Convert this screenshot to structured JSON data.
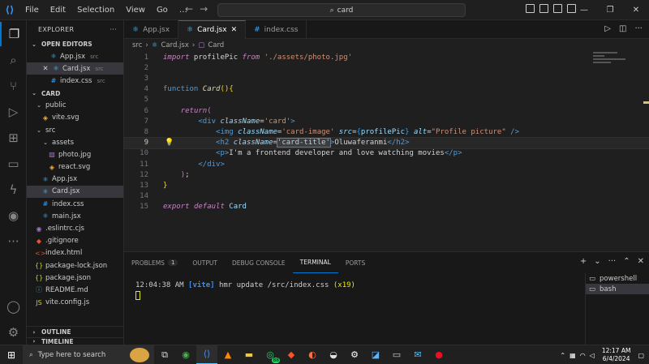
{
  "titlebar": {
    "menu": [
      "File",
      "Edit",
      "Selection",
      "View",
      "Go"
    ],
    "ellipsis": "…",
    "search": "card"
  },
  "sidebar": {
    "title": "EXPLORER",
    "more": "···",
    "open_editors_label": "OPEN EDITORS",
    "open_editors": [
      {
        "name": "App.jsx",
        "sub": "src",
        "icon": "react-icon",
        "close": false,
        "active": false
      },
      {
        "name": "Card.jsx",
        "sub": "src",
        "icon": "react-icon",
        "close": true,
        "active": true
      },
      {
        "name": "index.css",
        "sub": "src",
        "icon": "css-icon",
        "close": false,
        "active": false
      }
    ],
    "root_label": "CARD",
    "tree": [
      {
        "name": "public",
        "type": "folder",
        "depth": 1
      },
      {
        "name": "vite.svg",
        "type": "svg",
        "depth": 2
      },
      {
        "name": "src",
        "type": "folder",
        "depth": 1
      },
      {
        "name": "assets",
        "type": "folder",
        "depth": 2
      },
      {
        "name": "photo.jpg",
        "type": "img",
        "depth": 3
      },
      {
        "name": "react.svg",
        "type": "svg",
        "depth": 3
      },
      {
        "name": "App.jsx",
        "type": "react",
        "depth": 2
      },
      {
        "name": "Card.jsx",
        "type": "react",
        "depth": 2,
        "active": true
      },
      {
        "name": "index.css",
        "type": "css",
        "depth": 2
      },
      {
        "name": "main.jsx",
        "type": "react",
        "depth": 2
      },
      {
        "name": ".eslintrc.cjs",
        "type": "eslint",
        "depth": 1
      },
      {
        "name": ".gitignore",
        "type": "git",
        "depth": 1
      },
      {
        "name": "index.html",
        "type": "html",
        "depth": 1
      },
      {
        "name": "package-lock.json",
        "type": "json",
        "depth": 1
      },
      {
        "name": "package.json",
        "type": "json",
        "depth": 1
      },
      {
        "name": "README.md",
        "type": "md",
        "depth": 1
      },
      {
        "name": "vite.config.js",
        "type": "js",
        "depth": 1
      }
    ],
    "outline_label": "OUTLINE",
    "timeline_label": "TIMELINE"
  },
  "tabs": [
    {
      "label": "App.jsx",
      "active": false
    },
    {
      "label": "Card.jsx",
      "active": true
    },
    {
      "label": "index.css",
      "active": false
    }
  ],
  "breadcrumb": {
    "folder": "src",
    "file": "Card.jsx",
    "symbol": "Card"
  },
  "editor": {
    "current_line": 9,
    "lines": [
      [
        [
          "kw",
          "import"
        ],
        [
          "txt",
          " profilePic "
        ],
        [
          "kw",
          "from"
        ],
        [
          "txt",
          " "
        ],
        [
          "str",
          "'./assets/photo.jpg'"
        ]
      ],
      [],
      [],
      [
        [
          "tag",
          "function"
        ],
        [
          "txt",
          " "
        ],
        [
          "fn",
          "Card"
        ],
        [
          "brk1",
          "()"
        ],
        [
          "brk1",
          "{"
        ]
      ],
      [],
      [
        [
          "txt",
          "    "
        ],
        [
          "kw",
          "return"
        ],
        [
          "brk2",
          "("
        ]
      ],
      [
        [
          "txt",
          "        "
        ],
        [
          "tag",
          "<div"
        ],
        [
          "txt",
          " "
        ],
        [
          "attr",
          "className"
        ],
        [
          "txt",
          "="
        ],
        [
          "str",
          "'card'"
        ],
        [
          "tag",
          ">"
        ]
      ],
      [
        [
          "txt",
          "            "
        ],
        [
          "tag",
          "<img"
        ],
        [
          "txt",
          " "
        ],
        [
          "attr",
          "className"
        ],
        [
          "txt",
          "="
        ],
        [
          "str",
          "'card-image'"
        ],
        [
          "txt",
          " "
        ],
        [
          "attr",
          "src"
        ],
        [
          "txt",
          "="
        ],
        [
          "brk3",
          "{"
        ],
        [
          "var",
          "profilePic"
        ],
        [
          "brk3",
          "}"
        ],
        [
          "txt",
          " "
        ],
        [
          "attr",
          "alt"
        ],
        [
          "txt",
          "="
        ],
        [
          "str",
          "\"Profile picture\""
        ],
        [
          "txt",
          " "
        ],
        [
          "tag",
          "/>"
        ]
      ],
      [
        [
          "txt",
          "            "
        ],
        [
          "tag",
          "<h2"
        ],
        [
          "txt",
          " "
        ],
        [
          "attr",
          "className"
        ],
        [
          "txt",
          "="
        ],
        [
          "sel",
          "'card-title'"
        ],
        [
          "tag",
          ">"
        ],
        [
          "txt",
          "Oluwaferanmi"
        ],
        [
          "tag",
          "</h2>"
        ]
      ],
      [
        [
          "txt",
          "            "
        ],
        [
          "tag",
          "<p>"
        ],
        [
          "txt",
          "I'm a frontend developer and love watching movies"
        ],
        [
          "tag",
          "</p>"
        ]
      ],
      [
        [
          "txt",
          "        "
        ],
        [
          "tag",
          "</div>"
        ]
      ],
      [
        [
          "txt",
          "    "
        ],
        [
          "brk2",
          ")"
        ],
        [
          "txt",
          ";"
        ]
      ],
      [
        [
          "brk1",
          "}"
        ]
      ],
      [],
      [
        [
          "kw",
          "export"
        ],
        [
          "txt",
          " "
        ],
        [
          "kw",
          "default"
        ],
        [
          "txt",
          " "
        ],
        [
          "var",
          "Card"
        ]
      ]
    ]
  },
  "panel": {
    "tabs": [
      {
        "label": "PROBLEMS",
        "badge": "1",
        "active": false
      },
      {
        "label": "OUTPUT",
        "active": false
      },
      {
        "label": "DEBUG CONSOLE",
        "active": false
      },
      {
        "label": "TERMINAL",
        "active": true
      },
      {
        "label": "PORTS",
        "active": false
      }
    ],
    "terminal": {
      "time": "12:04:38 AM",
      "tag": "[vite]",
      "message": "hmr update /src/index.css",
      "count": "(x19)"
    },
    "terminals": [
      {
        "label": "powershell",
        "active": false
      },
      {
        "label": "bash",
        "active": true
      }
    ]
  },
  "taskbar": {
    "search_placeholder": "Type here to search",
    "tray_temp": "88",
    "time": "12:17 AM",
    "date": "6/4/2024"
  },
  "colors": {
    "accent": "#0078d4",
    "background": "#1f1f1f"
  }
}
